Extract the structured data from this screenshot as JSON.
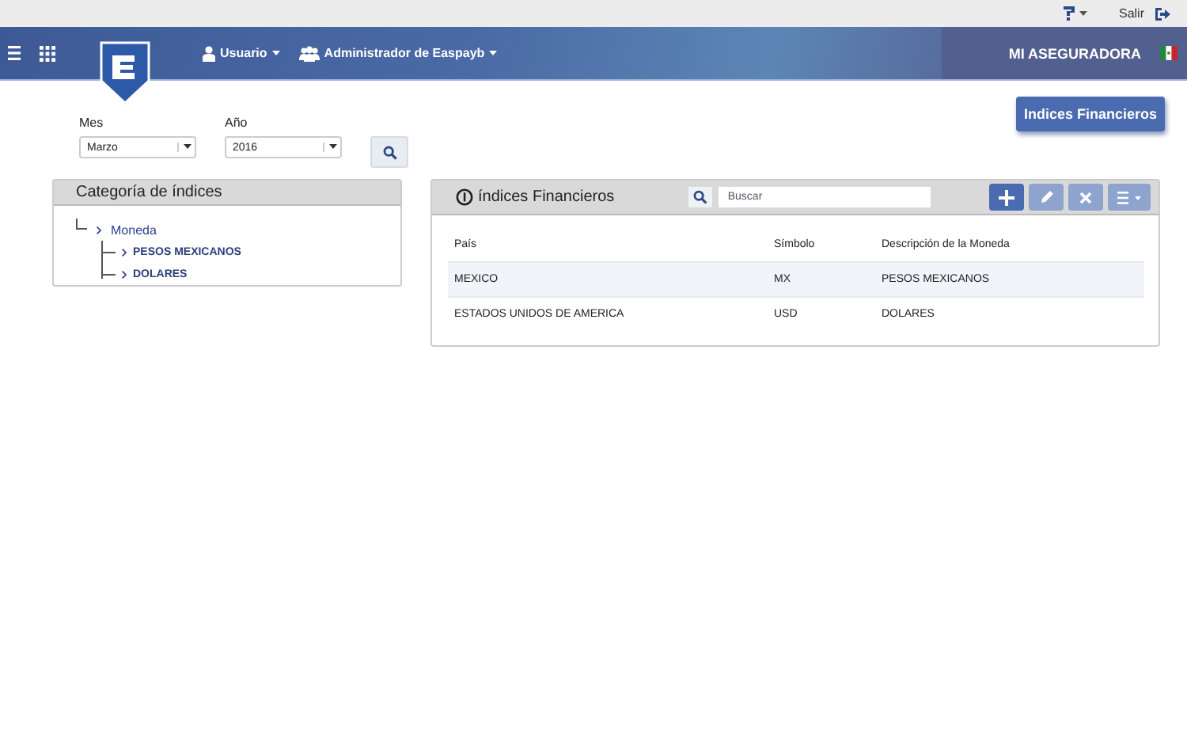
{
  "top_bar": {
    "logout": "Salir"
  },
  "header": {
    "menus": [
      {
        "label": "Usuario",
        "kind": "user"
      },
      {
        "label": "Administrador de Easpayb",
        "kind": "group"
      }
    ],
    "company": "MI ASEGURADORA"
  },
  "page_button": "Indices Financieros",
  "filters": [
    {
      "label": "Mes",
      "value": "Marzo"
    },
    {
      "label": "Año",
      "value": "2016"
    }
  ],
  "category_panel": {
    "title": "Categoría de índices",
    "tree": [
      {
        "label": "Moneda",
        "children": [
          {
            "label": "PESOS MEXICANOS"
          },
          {
            "label": "DOLARES"
          }
        ]
      }
    ]
  },
  "indices_panel": {
    "title": "índices Financieros",
    "search": {
      "placeholder": "Buscar"
    },
    "toolbar": [
      {
        "kind": "add",
        "disabled": false
      },
      {
        "kind": "edit",
        "disabled": true
      },
      {
        "kind": "delete",
        "disabled": true
      },
      {
        "kind": "menu",
        "disabled": true
      }
    ],
    "table": {
      "columns": [
        "País",
        "Símbolo",
        "Descripción de la Moneda"
      ],
      "rows": [
        {
          "cells": [
            "MEXICO",
            "MX",
            "PESOS MEXICANOS"
          ],
          "selected": true
        },
        {
          "cells": [
            "ESTADOS UNIDOS DE AMERICA",
            "USD",
            "DOLARES"
          ],
          "selected": false
        }
      ]
    }
  }
}
